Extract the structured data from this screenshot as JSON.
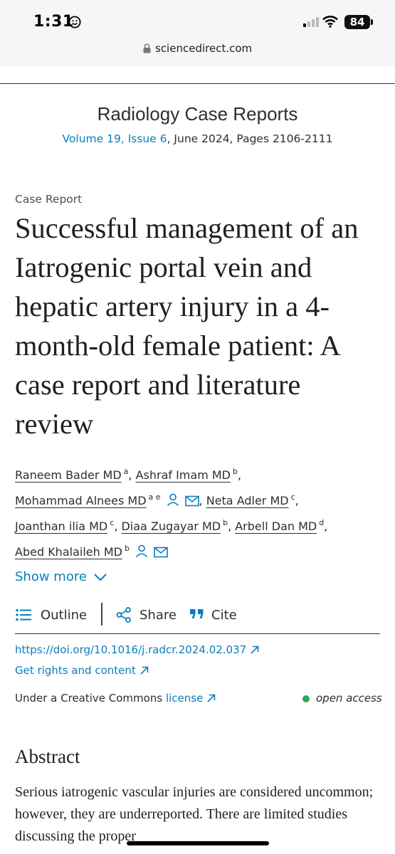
{
  "status_bar": {
    "time": "1:31",
    "battery": "84"
  },
  "browser": {
    "url": "sciencedirect.com"
  },
  "journal": {
    "name": "Radiology Case Reports",
    "issue_link": "Volume 19, Issue 6",
    "issue_rest": ", June 2024, Pages 2106-2111"
  },
  "article": {
    "type": "Case Report",
    "title": "Successful management of an Iatrogenic portal vein and hepatic artery injury in a 4-month-old female patient: A case report and literature review"
  },
  "authors": [
    {
      "name": "Raneem Bader MD",
      "aff": "a"
    },
    {
      "name": "Ashraf Imam MD",
      "aff": "b"
    },
    {
      "name": "Mohammad Alnees MD",
      "aff": "a e"
    },
    {
      "name": "Neta Adler MD",
      "aff": "c"
    },
    {
      "name": "Joanthan ilia MD",
      "aff": "c"
    },
    {
      "name": "Diaa Zugayar MD",
      "aff": "b"
    },
    {
      "name": "Arbell Dan MD",
      "aff": "d"
    },
    {
      "name": "Abed Khalaileh MD",
      "aff": "b"
    }
  ],
  "show_more": "Show more",
  "actions": {
    "outline": "Outline",
    "share": "Share",
    "cite": "Cite"
  },
  "links": {
    "doi": "https://doi.org/10.1016/j.radcr.2024.02.037",
    "rights": "Get rights and content"
  },
  "license": {
    "prefix": "Under a Creative Commons ",
    "link": "license",
    "access": "open access"
  },
  "abstract": {
    "heading": "Abstract",
    "text": "Serious iatrogenic vascular injuries are considered uncommon; however, they are underreported. There are limited studies discussing the proper"
  },
  "colors": {
    "link": "#0c7dbb",
    "open_access": "#31a84f"
  },
  "icons": [
    "smiley-icon",
    "signal-icon",
    "wifi-icon",
    "lock-icon",
    "person-icon",
    "mail-icon",
    "chevron-down-icon",
    "outline-list-icon",
    "share-icon",
    "quote-icon",
    "external-arrow-icon"
  ]
}
